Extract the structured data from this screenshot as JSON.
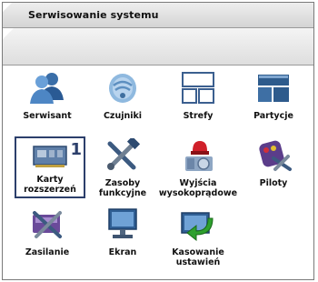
{
  "window": {
    "title": "Serwisowanie systemu"
  },
  "tiles": [
    {
      "label": "Serwisant",
      "icon": "users-icon"
    },
    {
      "label": "Czujniki",
      "icon": "sensor-icon"
    },
    {
      "label": "Strefy",
      "icon": "zones-icon"
    },
    {
      "label": "Partycje",
      "icon": "partitions-icon"
    },
    {
      "label_line1": "Karty",
      "label_line2": "rozszerzeń",
      "badge": "1",
      "icon": "expansion-card-icon",
      "selected": true
    },
    {
      "label_line1": "Zasoby",
      "label_line2": "funkcyjne",
      "icon": "tools-icon"
    },
    {
      "label_line1": "Wyjścia",
      "label_line2": "wysokoprądowe",
      "icon": "siren-icon"
    },
    {
      "label": "Piloty",
      "icon": "remote-icon"
    },
    {
      "label": "Zasilanie",
      "icon": "power-supply-icon"
    },
    {
      "label": "Ekran",
      "icon": "monitor-icon"
    },
    {
      "label_line1": "Kasowanie",
      "label_line2": "ustawień",
      "icon": "reset-icon"
    }
  ]
}
